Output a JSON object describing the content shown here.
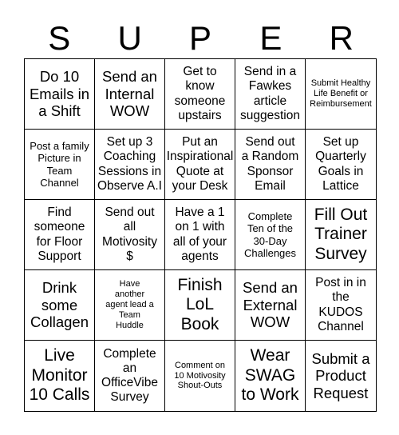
{
  "header": [
    "S",
    "U",
    "P",
    "E",
    "R"
  ],
  "cells": [
    "Do 10\nEmails in\na Shift",
    "Send an\nInternal\nWOW",
    "Get to\nknow\nsomeone\nupstairs",
    "Send in a\nFawkes\narticle\nsuggestion",
    "Submit Healthy\nLife Benefit or\nReimbursement",
    "Post a family\nPicture in\nTeam\nChannel",
    "Set up 3\nCoaching\nSessions in\nObserve A.I",
    "Put an\nInspirational\nQuote at\nyour Desk",
    "Send out\na Random\nSponsor\nEmail",
    "Set up\nQuarterly\nGoals in\nLattice",
    "Find\nsomeone\nfor Floor\nSupport",
    "Send out\nall\nMotivosity\n$",
    "Have a 1\non 1 with\nall of your\nagents",
    "Complete\nTen of the\n30-Day\nChallenges",
    "Fill Out\nTrainer\nSurvey",
    "Drink\nsome\nCollagen",
    "Have\nanother\nagent lead a\nTeam\nHuddle",
    "Finish\nLoL\nBook",
    "Send an\nExternal\nWOW",
    "Post in in\nthe\nKUDOS\nChannel",
    "Live\nMonitor\n10 Calls",
    "Complete\nan\nOfficeVibe\nSurvey",
    "Comment on\n10 Motivosity\nShout-Outs",
    "Wear\nSWAG\nto Work",
    "Submit a\nProduct\nRequest"
  ]
}
